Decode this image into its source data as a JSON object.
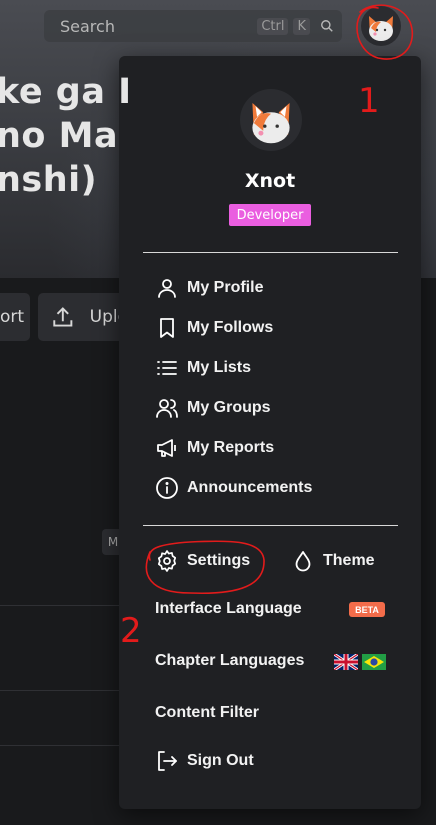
{
  "background": {
    "title_lines": "ke ga I\nno Ma\nnshi)",
    "buttons": [
      "ort",
      "Uplo"
    ],
    "chip": "M"
  },
  "search": {
    "placeholder": "Search",
    "shortcut_ctrl": "Ctrl",
    "shortcut_key": "K"
  },
  "user": {
    "name": "Xnot",
    "role": "Developer"
  },
  "menu": {
    "items": [
      {
        "label": "My Profile",
        "icon": "user-icon"
      },
      {
        "label": "My Follows",
        "icon": "bookmark-icon"
      },
      {
        "label": "My Lists",
        "icon": "list-icon"
      },
      {
        "label": "My Groups",
        "icon": "users-icon"
      },
      {
        "label": "My Reports",
        "icon": "megaphone-icon"
      },
      {
        "label": "Announcements",
        "icon": "info-icon"
      }
    ],
    "settings_label": "Settings",
    "theme_label": "Theme",
    "interface_language_label": "Interface Language",
    "beta_badge": "BETA",
    "chapter_languages_label": "Chapter Languages",
    "content_filter_label": "Content Filter",
    "sign_out_label": "Sign Out"
  },
  "annotations": {
    "mark_1": "1",
    "mark_2": "2",
    "color": "#e21b1b"
  },
  "colors": {
    "role_badge": "#ea5ee0",
    "beta_badge": "#f36c4a",
    "menu_bg": "#1f2023"
  }
}
